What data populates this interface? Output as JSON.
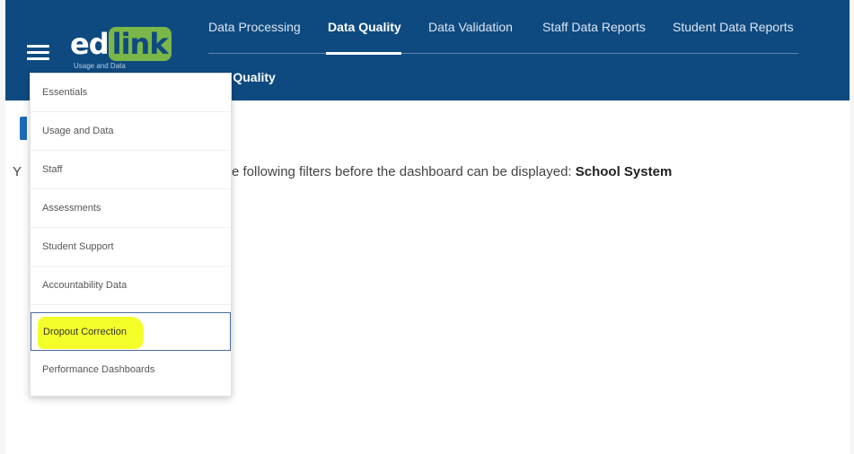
{
  "brand": {
    "logo_ed": "ed",
    "logo_link": "link",
    "logo_sub": "Usage and Data"
  },
  "nav": {
    "items": [
      {
        "label": "Data Processing"
      },
      {
        "label": "Data Quality"
      },
      {
        "label": "Data Validation"
      },
      {
        "label": "Staff Data Reports"
      },
      {
        "label": "Student Data Reports"
      }
    ],
    "active": "Data Quality"
  },
  "subtitle": "ta Quality",
  "main": {
    "message_prefix": "Y",
    "message_text": "e following filters before the dashboard can be displayed:",
    "message_filter": "School System"
  },
  "menu": {
    "items": [
      {
        "label": "Essentials"
      },
      {
        "label": "Usage and Data"
      },
      {
        "label": "Staff"
      },
      {
        "label": "Assessments"
      },
      {
        "label": "Student Support"
      },
      {
        "label": "Accountability Data"
      },
      {
        "label": "Dropout Correction"
      },
      {
        "label": "Performance Dashboards"
      }
    ],
    "selected": "Dropout Correction"
  },
  "colors": {
    "header_bg": "#0e4a80",
    "highlight": "#f4ff2a",
    "logo_accent": "#7ab648"
  },
  "icons": {
    "menu": "hamburger-icon"
  }
}
